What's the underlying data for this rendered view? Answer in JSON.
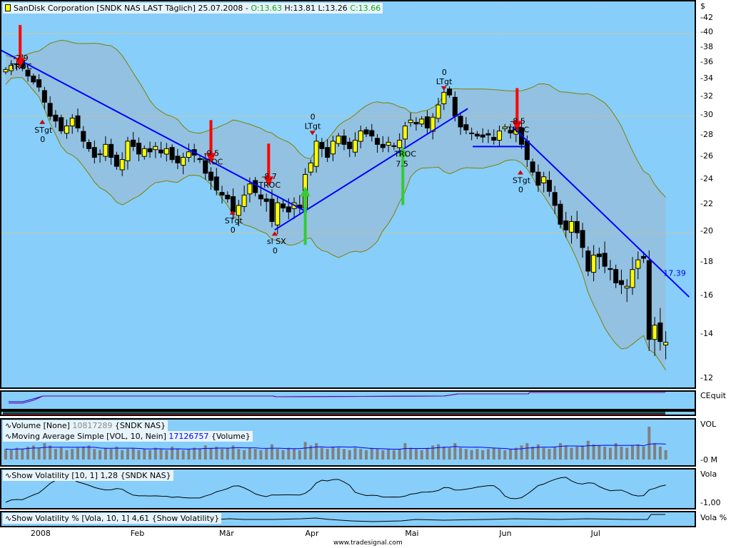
{
  "header": {
    "title": "SanDisk Corporation [SNDK NAS LAST Täglich] 25.07.2008 -",
    "open": "O:13.63",
    "high": "H:13.81",
    "low": "L:13.26",
    "close": "C:13.66"
  },
  "panels": {
    "cequit_label": "CEquit",
    "volume_legend": "Volume [None]",
    "volume_value": "10817289",
    "volume_source": "{SNDK NAS}",
    "ma_legend": "Moving Average Simple [VOL, 10, Nein]",
    "ma_value": "17126757",
    "ma_source": "{Volume}",
    "vol_axis_label": "VOL",
    "vol_axis_zero": "0 M",
    "vola_legend": "Show Volatility [10, 1] 1,28 {SNDK NAS}",
    "vola_axis_label": "Vola",
    "vola_axis_tick": "1,00",
    "volapct_legend": "Show Volatility % [Vola, 10, 1] 4,61 {Show Volatility}",
    "volapct_axis_label": "Vola %"
  },
  "watermark": "www.tradesignal.com",
  "colors": {
    "bg": "#87cefa",
    "up": "#ffff00",
    "down": "#000000",
    "trend": "#0000ff",
    "sell": "#ff0000",
    "buy": "#33cc33",
    "band": "#808000"
  },
  "chart_data": {
    "type": "candlestick",
    "y_scale": "log",
    "ylim": [
      12,
      42
    ],
    "currency_label": "$",
    "yticks": [
      42,
      40,
      38,
      36,
      34,
      32,
      30,
      28,
      26,
      24,
      22,
      20,
      18,
      16,
      14,
      12
    ],
    "xticks": [
      {
        "label": "2008",
        "index": 5
      },
      {
        "label": "Feb",
        "index": 23
      },
      {
        "label": "Mär",
        "index": 39
      },
      {
        "label": "Apr",
        "index": 54.5
      },
      {
        "label": "Mai",
        "index": 72.5
      },
      {
        "label": "Jun",
        "index": 89.5
      },
      {
        "label": "Jul",
        "index": 106
      }
    ],
    "closes": [
      35.3,
      35.8,
      36.0,
      35.5,
      34.5,
      33.8,
      33.2,
      31.5,
      30.0,
      29.5,
      28.5,
      29.0,
      29.8,
      28.8,
      27.5,
      26.8,
      26.0,
      26.3,
      27.2,
      26.0,
      25.2,
      25.8,
      27.5,
      27.0,
      26.3,
      26.8,
      26.5,
      27.0,
      26.4,
      26.8,
      25.8,
      25.5,
      26.0,
      26.5,
      26.2,
      25.8,
      24.6,
      24.0,
      23.2,
      22.8,
      22.5,
      21.5,
      22.0,
      22.8,
      23.7,
      23.0,
      22.5,
      22.3,
      20.8,
      22.2,
      21.8,
      21.5,
      22.2,
      21.8,
      24.5,
      25.5,
      27.5,
      26.8,
      26.0,
      27.5,
      28.0,
      27.2,
      26.8,
      27.6,
      28.5,
      28.2,
      28.0,
      27.2,
      26.9,
      27.4,
      27.0,
      27.6,
      29.0,
      29.6,
      29.2,
      29.7,
      28.8,
      29.9,
      31.2,
      32.6,
      32.3,
      30.0,
      28.9,
      28.6,
      28.3,
      28.0,
      27.9,
      28.1,
      27.6,
      28.5,
      28.9,
      28.3,
      28.7,
      27.2,
      25.8,
      24.7,
      23.6,
      24.3,
      23.1,
      22.0,
      20.6,
      20.2,
      20.8,
      20.0,
      19.0,
      17.5,
      18.5,
      18.4,
      17.8,
      17.6,
      16.8,
      16.7,
      16.6,
      17.6,
      18.2,
      18.3,
      13.8,
      14.5,
      13.7,
      13.66
    ],
    "volumes_m": [
      9,
      8,
      10,
      9,
      11,
      12,
      10,
      14,
      12,
      9,
      10,
      8,
      9,
      10,
      11,
      12,
      9,
      8,
      10,
      9,
      11,
      8,
      9,
      10,
      8,
      9,
      8,
      10,
      9,
      8,
      11,
      9,
      8,
      9,
      10,
      9,
      12,
      10,
      11,
      9,
      10,
      12,
      9,
      8,
      10,
      9,
      8,
      9,
      13,
      9,
      8,
      10,
      9,
      8,
      15,
      12,
      14,
      10,
      9,
      11,
      10,
      9,
      8,
      10,
      9,
      8,
      10,
      9,
      8,
      9,
      8,
      9,
      14,
      10,
      9,
      8,
      10,
      12,
      13,
      11,
      10,
      14,
      10,
      9,
      8,
      9,
      8,
      9,
      10,
      9,
      8,
      9,
      10,
      12,
      14,
      11,
      13,
      10,
      9,
      11,
      14,
      12,
      10,
      11,
      12,
      16,
      13,
      12,
      11,
      10,
      14,
      11,
      10,
      12,
      13,
      11,
      28,
      14,
      11,
      8
    ],
    "trendlines": [
      {
        "from": [
          -1,
          37.8
        ],
        "to": [
          54.3,
          21.5
        ]
      },
      {
        "from": [
          48.5,
          20.2
        ],
        "to": [
          83.3,
          30.8
        ]
      },
      {
        "from": [
          84.2,
          27.0
        ],
        "to": [
          93.8,
          27.0
        ]
      },
      {
        "from": [
          91.4,
          28.9
        ],
        "to": [
          123.2,
          16.0
        ],
        "label": "17.39"
      }
    ],
    "sell_signals": [
      {
        "index": 2.6,
        "price": 35.5,
        "value": "-7.9",
        "tag": "TROC"
      },
      {
        "index": 37,
        "price": 25.5,
        "value": "-9.5",
        "tag": "TROC"
      },
      {
        "index": 47.4,
        "price": 23.5,
        "value": "-8.7",
        "tag": "TROC"
      },
      {
        "index": 92.2,
        "price": 28.5,
        "value": "-8.5",
        "tag": "TROC"
      }
    ],
    "buy_signals": [
      {
        "index": 54,
        "price": 23.5
      },
      {
        "index": 71.6,
        "price": 27.0,
        "value": "7.5",
        "tag": "TROC"
      }
    ],
    "targets": [
      {
        "index": 6.6,
        "price": 29.2,
        "tag": "STgt",
        "value": "0",
        "dir": "up"
      },
      {
        "index": 40.9,
        "price": 21.3,
        "tag": "STgt",
        "value": "0",
        "dir": "up"
      },
      {
        "index": 92.8,
        "price": 24.5,
        "tag": "STgt",
        "value": "0",
        "dir": "up"
      },
      {
        "index": 55.3,
        "price": 28.5,
        "tag": "LTgt",
        "value": "0",
        "dir": "down"
      },
      {
        "index": 79,
        "price": 33.3,
        "tag": "LTgt",
        "value": "0",
        "dir": "down"
      },
      {
        "index": 48.5,
        "price": 19.8,
        "tag": "sl SX",
        "value": "0",
        "dir": "up"
      }
    ]
  }
}
